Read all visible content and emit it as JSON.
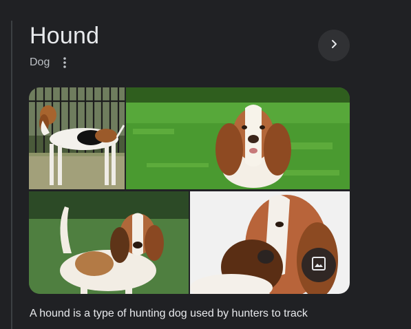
{
  "entity": {
    "title": "Hound",
    "subtitle": "Dog"
  },
  "icons": {
    "more": "more-vert-icon",
    "next": "chevron-right-icon",
    "images": "image-icon"
  },
  "gallery": {
    "images": [
      {
        "subject": "hound-standing-by-fence"
      },
      {
        "subject": "basset-hound-on-grass"
      },
      {
        "subject": "basset-hound-standing-outdoors"
      },
      {
        "subject": "basset-hound-portrait-white-background"
      }
    ]
  },
  "description": "A hound is a type of hunting dog used by hunters to track",
  "colors": {
    "background": "#202124",
    "text_primary": "#e8eaed",
    "text_secondary": "#bdc1c6",
    "button_bg": "#303134"
  }
}
